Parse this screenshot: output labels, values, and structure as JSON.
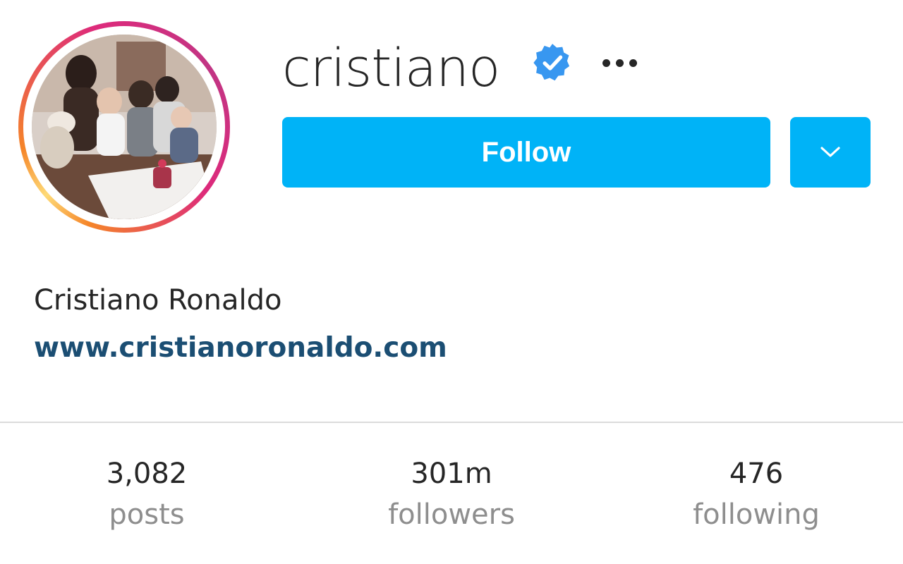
{
  "profile": {
    "username": "cristiano",
    "verified": true,
    "full_name": "Cristiano Ronaldo",
    "website": "www.cristianoronaldo.com"
  },
  "actions": {
    "follow_label": "Follow",
    "more_icon": "ellipsis-icon",
    "dropdown_icon": "chevron-down-icon"
  },
  "stats": [
    {
      "value": "3,082",
      "label": "posts"
    },
    {
      "value": "301m",
      "label": "followers"
    },
    {
      "value": "476",
      "label": "following"
    }
  ],
  "colors": {
    "accent": "#00b3f7",
    "link": "#1b4e73",
    "verified": "#3897f0",
    "muted": "#8e8e8e"
  }
}
